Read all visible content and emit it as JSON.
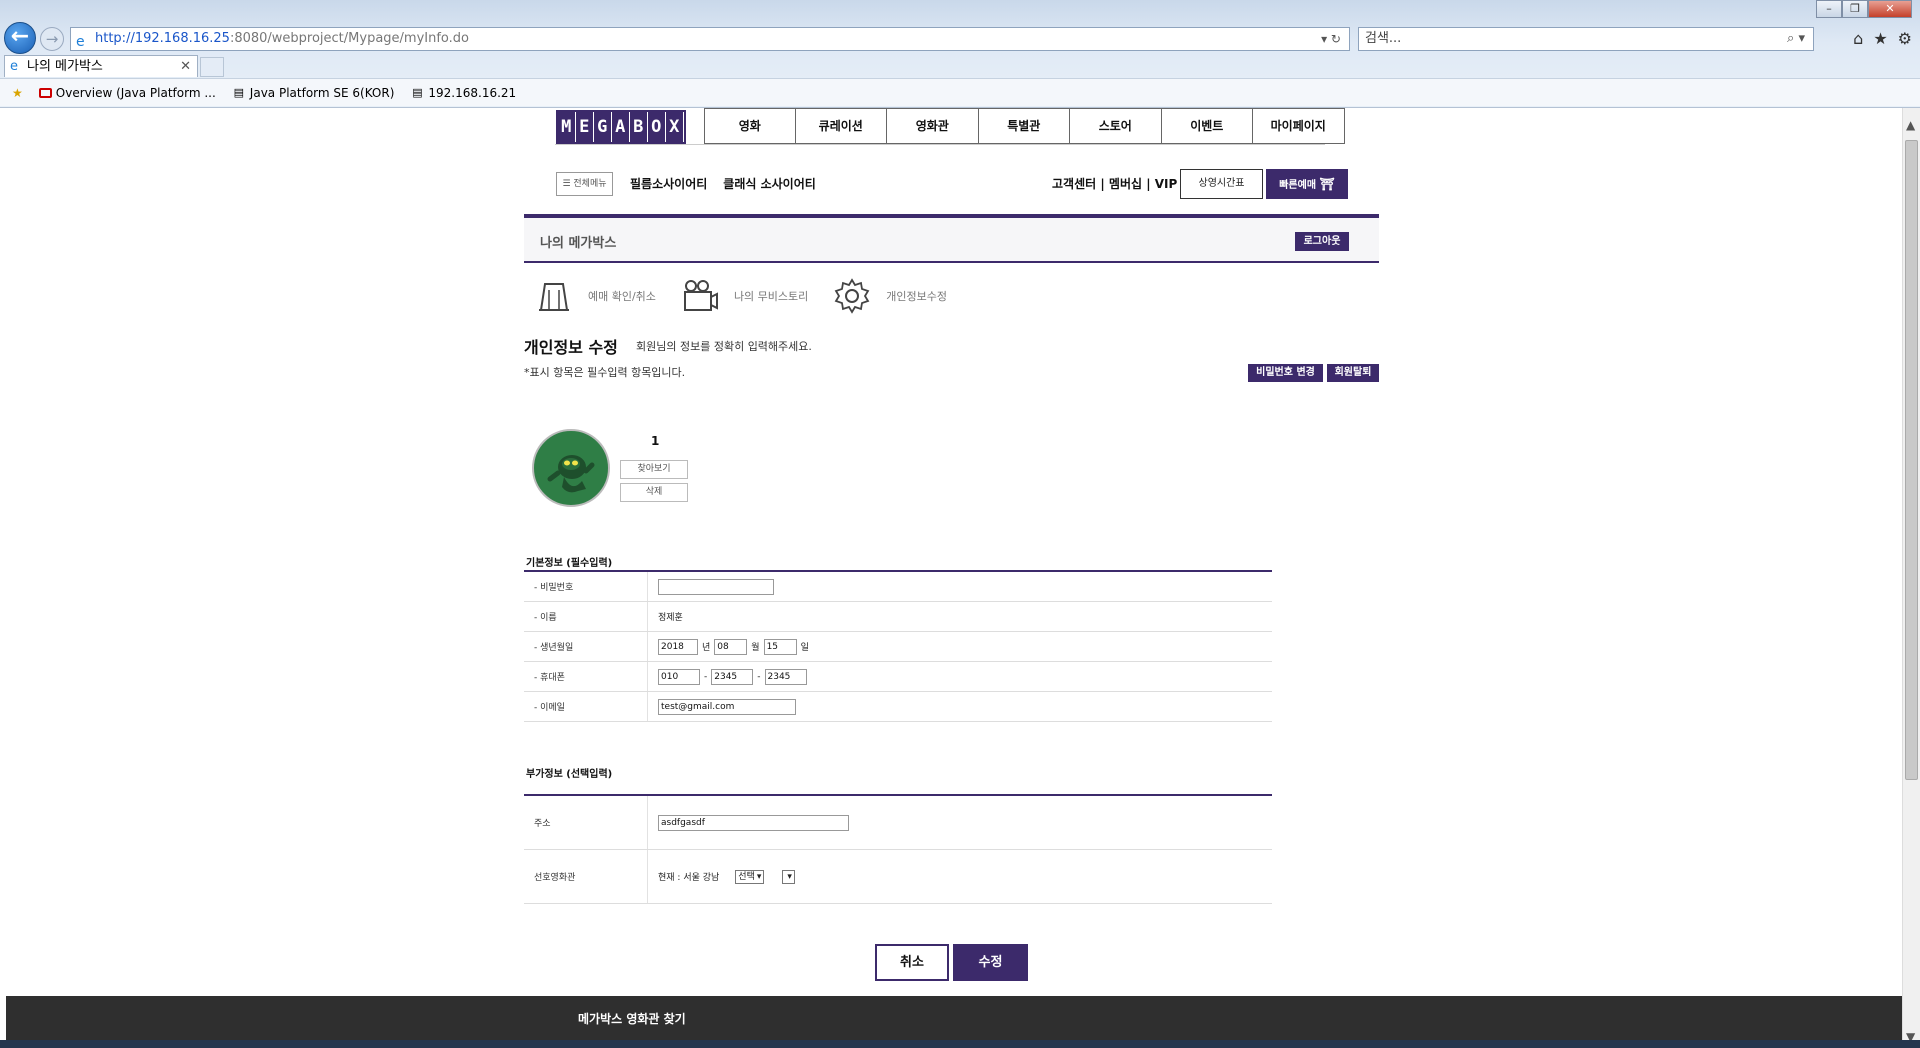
{
  "browser": {
    "url_host": "http://192.168.16.25",
    "url_rest": ":8080/webproject/Mypage/myInfo.do",
    "search_placeholder": "검색...",
    "tab_title": "나의 메가박스",
    "favorites": [
      "Overview (Java Platform ...",
      "Java Platform SE 6(KOR)",
      "192.168.16.21"
    ]
  },
  "site": {
    "logo_letters": [
      "M",
      "E",
      "G",
      "A",
      "B",
      "O",
      "X"
    ],
    "nav": [
      "영화",
      "큐레이션",
      "영화관",
      "특별관",
      "스토어",
      "이벤트",
      "마이페이지"
    ],
    "all_menu": "☰ 전체메뉴",
    "sub_links": [
      "필름소사이어티",
      "클래식 소사이어티"
    ],
    "util_links": "고객센터 | 멤버십 | VIP",
    "timetable": "상영시간표",
    "quick_booking": "빠른예매"
  },
  "mypage": {
    "title": "나의 메가박스",
    "logout": "로그아웃",
    "menu": [
      "예매 확인/취소",
      "나의 무비스토리",
      "개인정보수정"
    ]
  },
  "edit": {
    "title": "개인정보 수정",
    "desc": "회원님의 정보를 정확히 입력해주세요.",
    "required_note": "*표시 항목은 필수입력 항목입니다.",
    "pw_change": "비밀번호 변경",
    "withdraw": "회원탈퇴",
    "profile_name": "1",
    "browse": "찾아보기",
    "delete": "삭제"
  },
  "basic": {
    "title": "기본정보 (필수입력)",
    "password_label": "- 비밀번호",
    "password_value": "",
    "name_label": "- 이름",
    "name_value": "정제훈",
    "birth_label": "- 생년월일",
    "birth_year": "2018",
    "birth_year_unit": "년",
    "birth_month": "08",
    "birth_month_unit": "월",
    "birth_day": "15",
    "birth_day_unit": "일",
    "phone_label": "- 휴대폰",
    "phone_1": "010",
    "phone_2": "2345",
    "phone_3": "2345",
    "phone_sep": "-",
    "email_label": "- 이메일",
    "email_value": "test@gmail.com"
  },
  "extra": {
    "title": "부가정보 (선택입력)",
    "address_label": "주소",
    "address_value": "asdfgasdf",
    "theater_label": "선호영화관",
    "theater_current": "현재 : 서울 강남",
    "theater_select": "선택",
    "theater_select2": ""
  },
  "actions": {
    "cancel": "취소",
    "submit": "수정"
  },
  "footer": {
    "title": "메가박스 영화관 찾기"
  }
}
